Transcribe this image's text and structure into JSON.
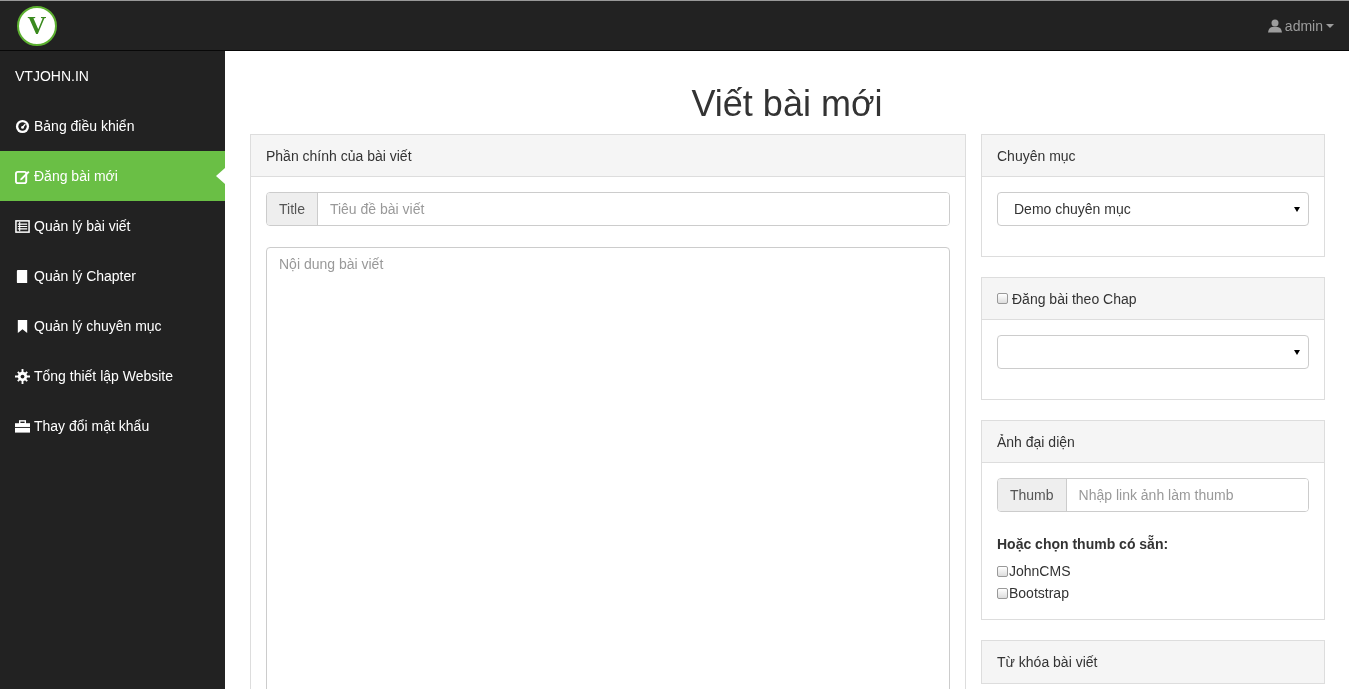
{
  "topbar": {
    "logo_letter": "V",
    "user": "admin"
  },
  "sidebar": {
    "brand": "VTJOHN.IN",
    "items": [
      {
        "label": "Bảng điều khiển",
        "selected": false
      },
      {
        "label": "Đăng bài mới",
        "selected": true
      },
      {
        "label": "Quản lý bài viết",
        "selected": false
      },
      {
        "label": "Quản lý Chapter",
        "selected": false
      },
      {
        "label": "Quản lý chuyên mục",
        "selected": false
      },
      {
        "label": "Tổng thiết lập Website",
        "selected": false
      },
      {
        "label": "Thay đổi mật khẩu",
        "selected": false
      }
    ]
  },
  "page_title": "Viết bài mới",
  "main_panel": {
    "heading": "Phần chính của bài viết",
    "title_addon": "Title",
    "title_placeholder": "Tiêu đề bài viết",
    "content_placeholder": "Nội dung bài viết"
  },
  "category_panel": {
    "heading": "Chuyên mục",
    "select_value": "Demo chuyên mục"
  },
  "chapter_panel": {
    "heading": "Đăng bài theo Chap",
    "checked": false
  },
  "thumb_panel": {
    "heading": "Ảnh đại diện",
    "addon": "Thumb",
    "placeholder": "Nhập link ảnh làm thumb",
    "choose_label": "Hoặc chọn thumb có sẵn:",
    "options": [
      {
        "label": "JohnCMS",
        "checked": false
      },
      {
        "label": "Bootstrap",
        "checked": false
      }
    ]
  },
  "tags_panel": {
    "heading": "Từ khóa bài viết"
  }
}
